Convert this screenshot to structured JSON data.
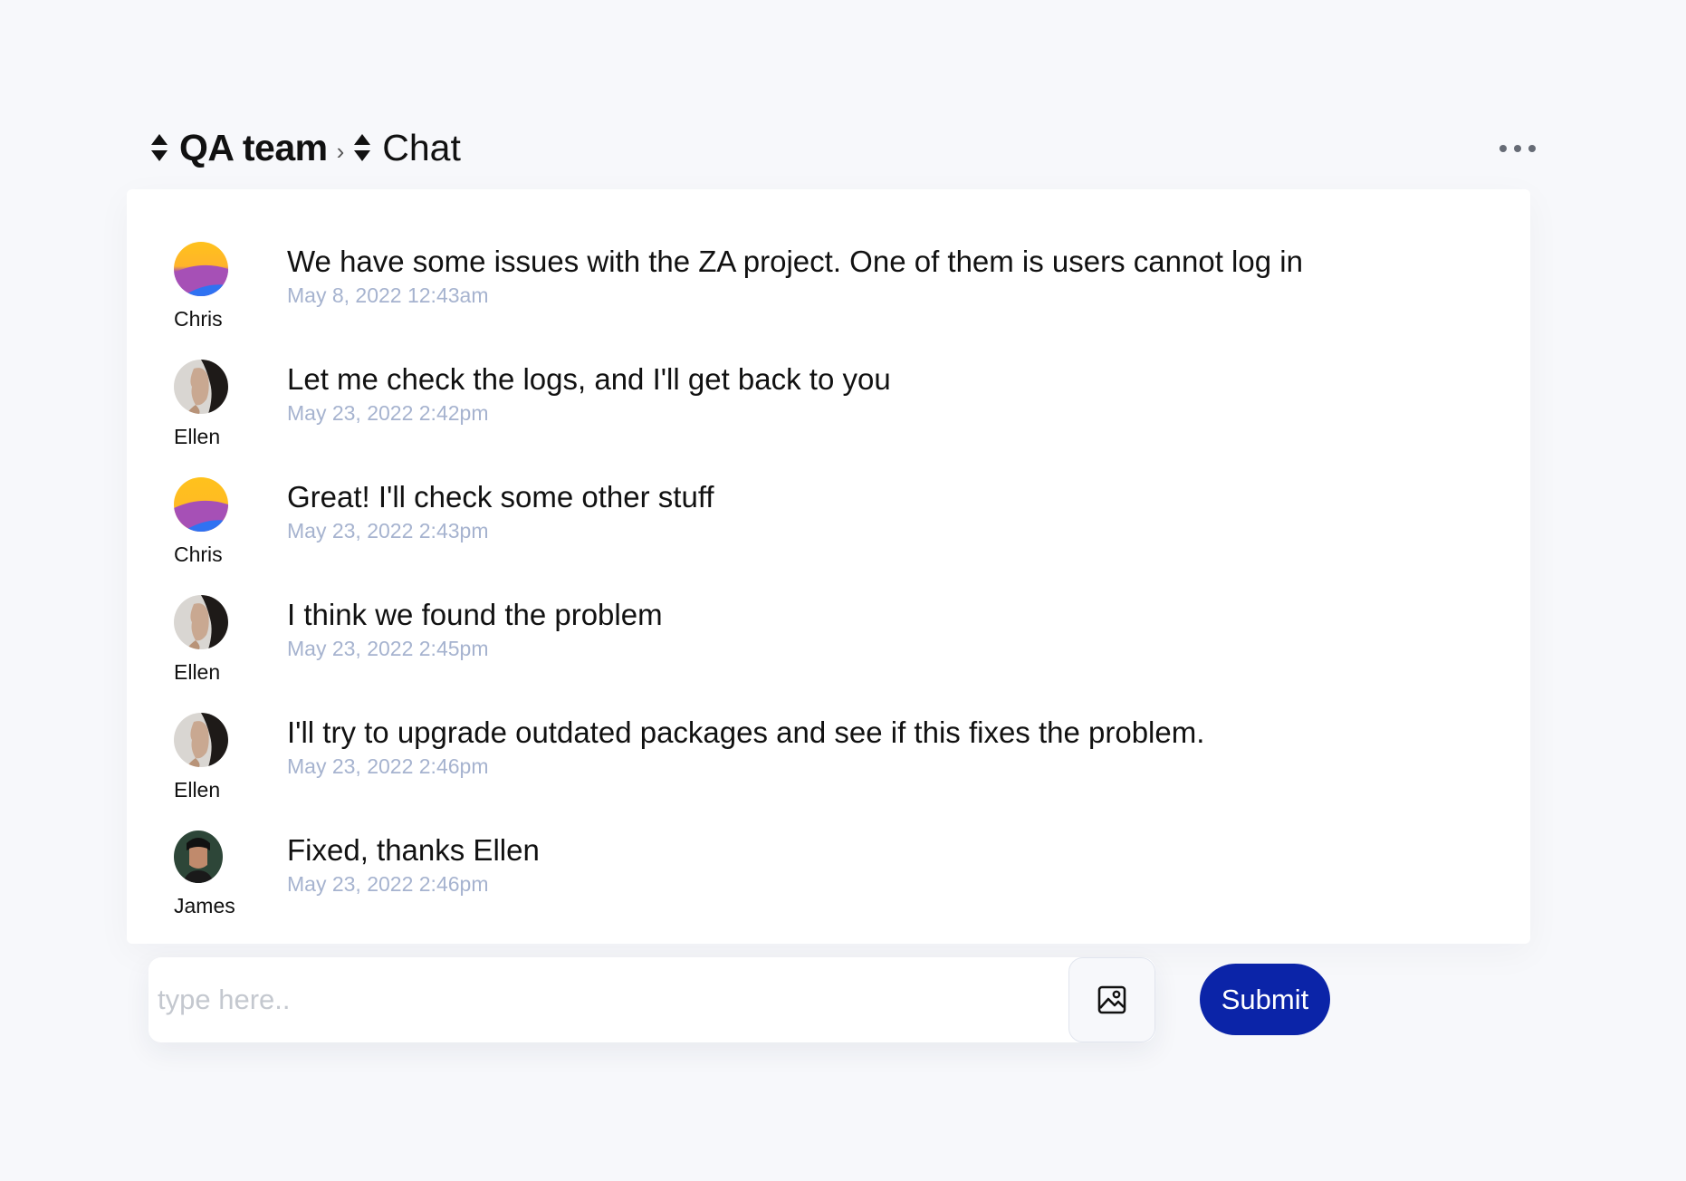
{
  "header": {
    "team": "QA team",
    "separator": "›",
    "section": "Chat",
    "more_icon": "more-horizontal-icon"
  },
  "messages": [
    {
      "author": "Chris",
      "avatar": "gradient",
      "text": "We have some issues with the ZA project. One of them is users cannot log in",
      "time": "May 8, 2022 12:43am"
    },
    {
      "author": "Ellen",
      "avatar": "photo-woman",
      "text": "Let me check the logs, and I'll get back to you",
      "time": "May 23, 2022 2:42pm"
    },
    {
      "author": "Chris",
      "avatar": "gradient",
      "text": "Great! I'll check some other stuff",
      "time": "May 23, 2022 2:43pm"
    },
    {
      "author": "Ellen",
      "avatar": "photo-woman",
      "text": "I think we found the problem",
      "time": "May 23, 2022 2:45pm"
    },
    {
      "author": "Ellen",
      "avatar": "photo-woman",
      "text": "I'll try to upgrade outdated packages and see if this fixes the problem.",
      "time": "May 23, 2022 2:46pm"
    },
    {
      "author": "James",
      "avatar": "photo-man",
      "text": "Fixed, thanks Ellen",
      "time": "May 23, 2022 2:46pm"
    }
  ],
  "composer": {
    "placeholder": "type here..",
    "value": "",
    "image_icon": "image-icon",
    "submit_label": "Submit"
  },
  "colors": {
    "background": "#f7f8fb",
    "accent": "#0b24a8",
    "timestamp": "#a6b3cf"
  }
}
